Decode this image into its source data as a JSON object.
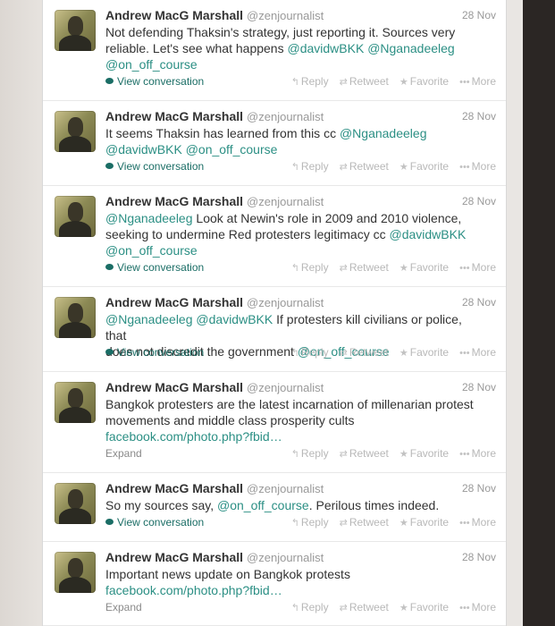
{
  "tweets": [
    {
      "name": "Andrew MacG Marshall",
      "screen_name": "@zenjournalist",
      "time": "28 Nov",
      "lines": [
        [
          {
            "t": "Not defending Thaksin's strategy, just reporting it. Sources very"
          }
        ],
        [
          {
            "t": "reliable. Let's see what happens "
          },
          {
            "t": "@davidwBKK",
            "l": true
          },
          {
            "t": " "
          },
          {
            "t": "@Nganadeeleg",
            "l": true
          }
        ],
        [
          {
            "t": "@on_off_course",
            "l": true
          }
        ]
      ],
      "footer_label": "View conversation",
      "footer_type": "conversation"
    },
    {
      "name": "Andrew MacG Marshall",
      "screen_name": "@zenjournalist",
      "time": "28 Nov",
      "lines": [
        [
          {
            "t": "It seems Thaksin has learned from this cc "
          },
          {
            "t": "@Nganadeeleg",
            "l": true
          }
        ],
        [
          {
            "t": "@davidwBKK",
            "l": true
          },
          {
            "t": " "
          },
          {
            "t": "@on_off_course",
            "l": true
          }
        ]
      ],
      "footer_label": "View conversation",
      "footer_type": "conversation"
    },
    {
      "name": "Andrew MacG Marshall",
      "screen_name": "@zenjournalist",
      "time": "28 Nov",
      "lines": [
        [
          {
            "t": "@Nganadeeleg",
            "l": true
          },
          {
            "t": " Look at Newin's role in 2009 and 2010 violence,"
          }
        ],
        [
          {
            "t": "seeking to undermine Red protesters legitimacy cc "
          },
          {
            "t": "@davidwBKK",
            "l": true
          }
        ],
        [
          {
            "t": "@on_off_course",
            "l": true
          }
        ]
      ],
      "footer_label": "View conversation",
      "footer_type": "conversation"
    },
    {
      "name": "Andrew MacG Marshall",
      "screen_name": "@zenjournalist",
      "time": "28 Nov",
      "lines": [
        [
          {
            "t": "@Nganadeeleg",
            "l": true
          },
          {
            "t": " "
          },
          {
            "t": "@davidwBKK",
            "l": true
          },
          {
            "t": " If protesters kill civilians or police, that"
          }
        ],
        [
          {
            "t": "does not discredit the government "
          },
          {
            "t": "@on_off_course",
            "l": true
          }
        ]
      ],
      "footer_label": "View conversation",
      "footer_type": "conversation"
    },
    {
      "name": "Andrew MacG Marshall",
      "screen_name": "@zenjournalist",
      "time": "28 Nov",
      "lines": [
        [
          {
            "t": "Bangkok protesters are the latest incarnation of millenarian protest"
          }
        ],
        [
          {
            "t": "movements and middle class prosperity cults"
          }
        ],
        [
          {
            "t": "facebook.com/photo.php?fbid…",
            "l": true
          }
        ]
      ],
      "footer_label": "Expand",
      "footer_type": "expand"
    },
    {
      "name": "Andrew MacG Marshall",
      "screen_name": "@zenjournalist",
      "time": "28 Nov",
      "lines": [
        [
          {
            "t": "So my sources say, "
          },
          {
            "t": "@on_off_course",
            "l": true
          },
          {
            "t": ". Perilous times indeed."
          }
        ]
      ],
      "footer_label": "View conversation",
      "footer_type": "conversation"
    },
    {
      "name": "Andrew MacG Marshall",
      "screen_name": "@zenjournalist",
      "time": "28 Nov",
      "lines": [
        [
          {
            "t": "Important news update on Bangkok protests"
          }
        ],
        [
          {
            "t": "facebook.com/photo.php?fbid…",
            "l": true
          }
        ]
      ],
      "footer_label": "Expand",
      "footer_type": "expand"
    }
  ],
  "actions": [
    {
      "label": "Reply",
      "icon": "reply-icon",
      "glyph": "↰"
    },
    {
      "label": "Retweet",
      "icon": "retweet-icon",
      "glyph": "⇄"
    },
    {
      "label": "Favorite",
      "icon": "favorite-icon",
      "glyph": "★"
    },
    {
      "label": "More",
      "icon": "more-icon",
      "glyph": "•••"
    }
  ],
  "colors": {
    "link": "#2b8f84",
    "text": "#333333",
    "muted": "#999999"
  }
}
